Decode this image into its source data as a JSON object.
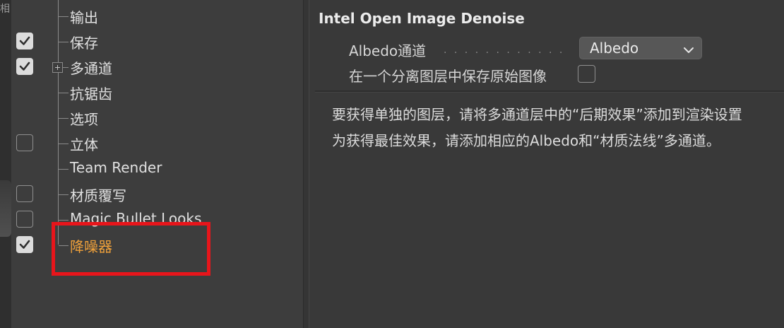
{
  "window": {
    "edge_char": "相"
  },
  "tree": {
    "items": [
      {
        "label": "输出",
        "checkbox": "none"
      },
      {
        "label": "保存",
        "checkbox": "checked"
      },
      {
        "label": "多通道",
        "checkbox": "checked",
        "expandable": true
      },
      {
        "label": "抗锯齿",
        "checkbox": "none"
      },
      {
        "label": "选项",
        "checkbox": "none"
      },
      {
        "label": "立体",
        "checkbox": "unchecked"
      },
      {
        "label": "Team Render",
        "checkbox": "none"
      },
      {
        "label": "材质覆写",
        "checkbox": "unchecked"
      },
      {
        "label": "Magic Bullet Looks",
        "checkbox": "unchecked"
      },
      {
        "label": "降噪器",
        "checkbox": "checked",
        "selected": true
      }
    ]
  },
  "settings": {
    "title": "Intel Open Image Denoise",
    "albedo_label": "Albedo通道",
    "albedo_dots": ". . . . . . . . . . . . . .",
    "albedo_value": "Albedo",
    "keep_original_label": "在一个分离图层中保存原始图像",
    "keep_original_checked": false,
    "info_line1": "要获得单独的图层，请将多通道层中的“后期效果”添加到渲染设置",
    "info_line2": "为获得最佳效果，请添加相应的Albedo和“材质法线”多通道。"
  },
  "colors": {
    "selected_text": "#f0a13a",
    "highlight_border": "#e8151b"
  }
}
